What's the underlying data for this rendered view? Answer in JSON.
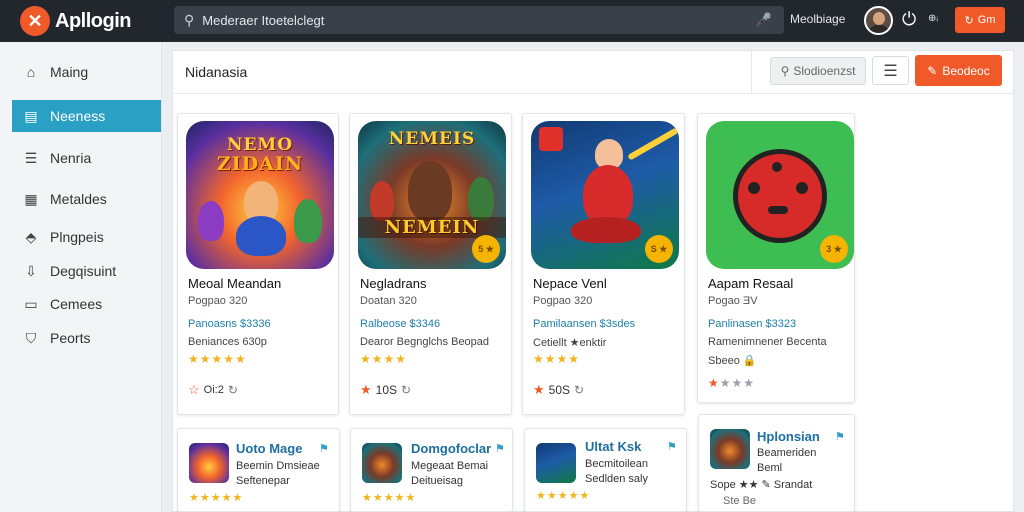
{
  "app": {
    "name": "Apllogin"
  },
  "topbar": {
    "search_value": "Mederaer Itoetelclegt",
    "link": "Meolbiage",
    "small_label": "⊕ᵢ",
    "cta_label": "Gm"
  },
  "sidebar": {
    "items": [
      {
        "label": "Maing",
        "icon": "home-icon"
      },
      {
        "label": "Neeness",
        "icon": "document-icon",
        "active": true
      },
      {
        "label": "Nenria",
        "icon": "menu-icon"
      },
      {
        "label": "Metaldes",
        "icon": "grid-icon"
      },
      {
        "label": "Plngpeis",
        "icon": "tag-icon"
      },
      {
        "label": "Degqisuint",
        "icon": "download-icon"
      },
      {
        "label": "Cemees",
        "icon": "chat-icon"
      },
      {
        "label": "Peorts",
        "icon": "bookmark-icon"
      }
    ]
  },
  "main": {
    "title": "Nidanasia",
    "sort_label": "Slodioenzst",
    "primary_label": "Beodeoc"
  },
  "featured": [
    {
      "name": "Meoal Meandan",
      "sub": "Pogpao 320",
      "price": "Panoasns $3336",
      "info": "Beniances 630p",
      "stars": "★★★★★",
      "foot": "Oi:2",
      "art_text": "NEMO\nZIDAIN"
    },
    {
      "name": "Negladrans",
      "sub": "Doatan 320",
      "price": "Ralbeose $3346",
      "info": "Dearor Begnglchs Beopad",
      "stars": "★★★★",
      "foot": "10S",
      "art_text": "NEMEIN",
      "badge": "5 ★"
    },
    {
      "name": "Nepace Venl",
      "sub": "Pogpao 320",
      "price": "Pamilaansen $3sdes",
      "info": "Cetiellt ★enktir",
      "stars": "★★★★",
      "foot": "50S",
      "badge": "S ★"
    },
    {
      "name": "Aapam Resaal",
      "sub": "Pogao ƎV",
      "price": "Panlinasen $3323",
      "info": "Ramenimnener Becenta",
      "info2": "Sbeeo 🔒",
      "stars": "★★★★",
      "foot": "",
      "badge": "3 ★"
    }
  ],
  "small_cards": [
    {
      "title": "Uoto Mage",
      "line1": "Beemin Dmsieae",
      "line2": "Seftenepar",
      "stars": "★★★★★"
    },
    {
      "title": "Domgofoclar",
      "line1": "Megeaat Bemai",
      "line2": "Deitueisag",
      "stars": "★★★★★"
    },
    {
      "title": "Ultat Ksk",
      "line1": "Becmitoilean",
      "line2": "Sedlden saly",
      "stars": "★★★★★"
    },
    {
      "title": "Hplonsian",
      "line1": "Beameriden",
      "line2": "Beml",
      "line3": "Sope ★★ ✎ Srandat",
      "line4": "Ste Be"
    }
  ]
}
